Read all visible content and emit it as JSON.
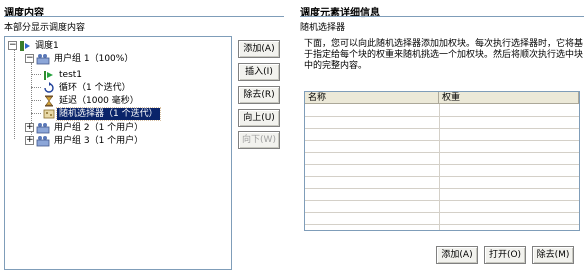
{
  "left_panel": {
    "title": "调度内容",
    "subtitle": "本部分显示调度内容",
    "tree": {
      "root": {
        "label": "调度1",
        "expanded": true
      },
      "group1": {
        "label": "用户组 1（100%）",
        "expanded": true
      },
      "children": [
        {
          "label": "test1",
          "icon": "test-step-icon"
        },
        {
          "label": "循环（1 个迭代）",
          "icon": "loop-icon"
        },
        {
          "label": "延迟（1000 毫秒）",
          "icon": "hourglass-icon"
        },
        {
          "label": "随机选择器（1 个迭代）",
          "icon": "random-selector-icon",
          "selected": true
        }
      ],
      "group2": {
        "label": "用户组 2（1 个用户）",
        "expanded": false
      },
      "group3": {
        "label": "用户组 3（1 个用户）",
        "expanded": false
      }
    },
    "buttons": {
      "add": "添加(A)",
      "insert": "插入(I)",
      "remove": "除去(R)",
      "up": "向上(U)",
      "down": "向下(W)"
    }
  },
  "right_panel": {
    "title": "调度元素详细信息",
    "subtitle": "随机选择器",
    "description": "下面，您可以向此随机选择器添加加权块。每次执行选择器时，它将基于指定给每个块的权重来随机挑选一个加权块。然后将顺次执行选中块中的完整内容。",
    "table": {
      "columns": [
        "名称",
        "权重"
      ],
      "rows": []
    },
    "buttons": {
      "add": "添加(A)",
      "open": "打开(O)",
      "remove": "除去(M)"
    }
  }
}
